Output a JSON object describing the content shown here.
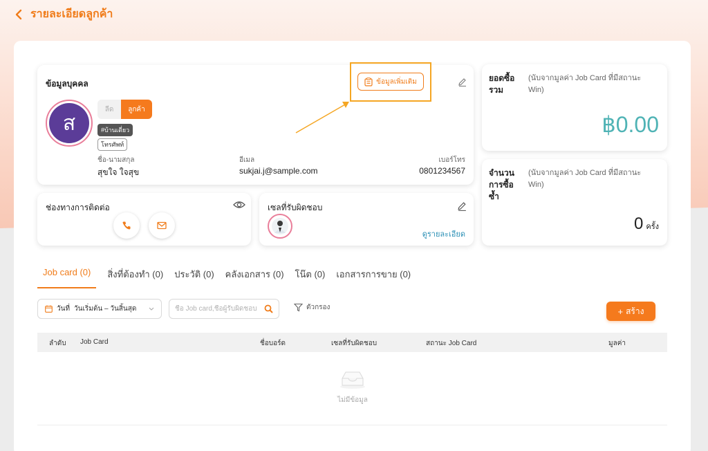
{
  "header": {
    "title": "รายละเอียดลูกค้า"
  },
  "personal": {
    "title": "ข้อมูลบุคคล",
    "more_button": "ข้อมูลเพิ่มเติม",
    "avatar_letter": "ส",
    "toggle_off": "ลีด",
    "toggle_on": "ลูกค้า",
    "tag_dark": "#บ้านเดี่ยว",
    "tag_light": "โทรศัพท์",
    "name_label": "ชื่อ-นามสกุล",
    "name_value": "สุขใจ ใจสุข",
    "email_label": "อีเมล",
    "email_value": "sukjai.j@sample.com",
    "phone_label": "เบอร์โทร",
    "phone_value": "0801234567"
  },
  "total_sales": {
    "title": "ยอดซื้อรวม",
    "note": "(นับจากมูลค่า Job Card ที่มีสถานะ Win)",
    "amount": "฿0.00"
  },
  "repeat_purchase": {
    "title": "จำนวนการซื้อซ้ำ",
    "note": "(นับจากมูลค่า Job Card ที่มีสถานะ Win)",
    "count": "0",
    "unit": "ครั้ง"
  },
  "contact": {
    "title": "ช่องทางการติดต่อ"
  },
  "sales_rep": {
    "title": "เซลที่รับผิดชอบ",
    "link": "ดูรายละเอียด"
  },
  "tabs": [
    {
      "label": "Job card (0)"
    },
    {
      "label": "สิ่งที่ต้องทำ (0)"
    },
    {
      "label": "ประวัติ (0)"
    },
    {
      "label": "คลังเอกสาร (0)"
    },
    {
      "label": "โน๊ต (0)"
    },
    {
      "label": "เอกสารการขาย (0)"
    }
  ],
  "filters": {
    "date_label": "วันที่",
    "date_range": "วันเริ่มต้น – วันสิ้นสุด",
    "search_placeholder": "ชื่อ Job card,ชื่อผู้รับผิดชอบ",
    "filter_label": "ตัวกรอง",
    "create_label": "สร้าง"
  },
  "table": {
    "columns": [
      "ลำดับ",
      "Job Card",
      "ชื่อบอร์ด",
      "เซลที่รับผิดชอบ",
      "สถานะ Job Card",
      "มูลค่า"
    ],
    "empty_text": "ไม่มีข้อมูล"
  },
  "colors": {
    "accent": "#f57a1d",
    "amount": "#4fb3b5",
    "avatar": "#5b3c98",
    "highlight": "#f5a623"
  }
}
